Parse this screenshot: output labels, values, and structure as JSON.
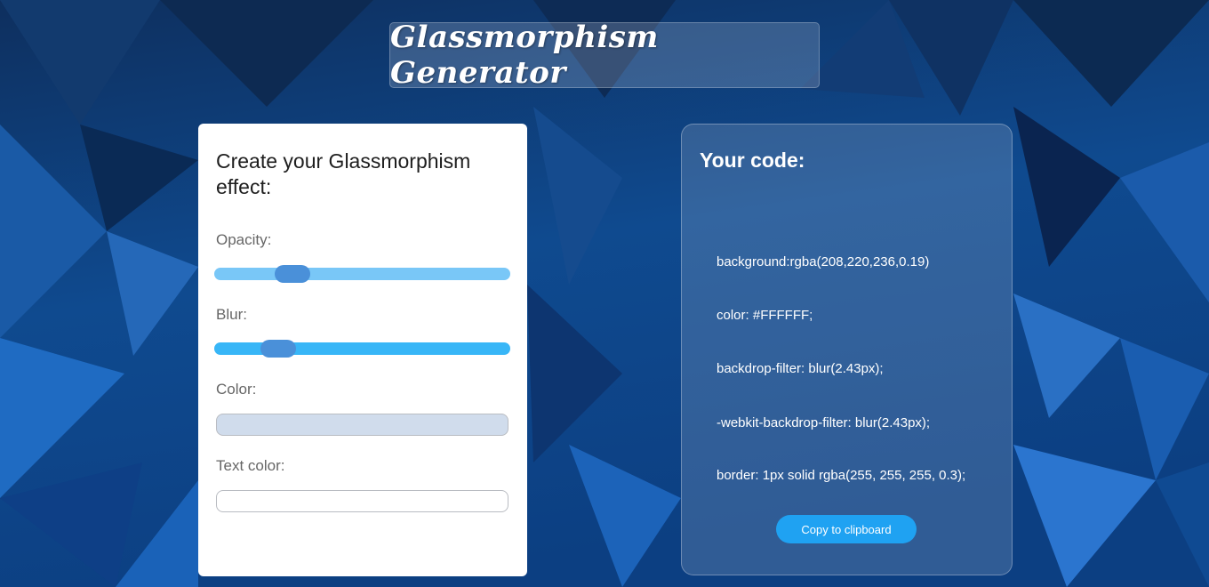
{
  "header": {
    "title": "Glassmorphism Generator"
  },
  "controls": {
    "heading": "Create your Glassmorphism effect:",
    "opacity": {
      "label": "Opacity:",
      "value": 0.19,
      "track_color": "#79c7f7"
    },
    "blur": {
      "label": "Blur:",
      "value": 2.43,
      "track_color": "#38b6f7"
    },
    "color": {
      "label": "Color:",
      "value": "#d0dcec"
    },
    "text_color": {
      "label": "Text color:",
      "value": "#ffffff"
    },
    "thumb_color": "#4a90d9"
  },
  "code": {
    "heading": "Your code:",
    "lines": [
      "background:rgba(208,220,236,0.19)",
      "color: #FFFFFF;",
      "backdrop-filter: blur(2.43px);",
      "-webkit-backdrop-filter: blur(2.43px);",
      "border: 1px solid rgba(255, 255, 255, 0.3);"
    ],
    "copy_label": "Copy to clipboard"
  },
  "colors": {
    "background_dark": "#0b2d5c",
    "background_mid": "#1456a0",
    "accent": "#1fa2f2"
  }
}
